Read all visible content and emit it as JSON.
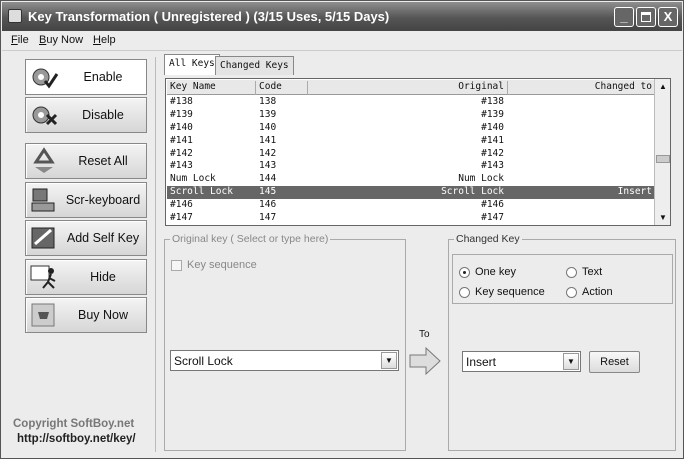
{
  "window": {
    "title": "Key Transformation ( Unregistered ) (3/15 Uses, 5/15 Days)",
    "minimize": "_",
    "maximize": "□",
    "close": "X"
  },
  "menu": [
    "File",
    "Buy Now",
    "Help"
  ],
  "menu_hotkeys": [
    "F",
    "B",
    "H"
  ],
  "sidebar": {
    "buttons": [
      {
        "label": "Enable",
        "icon": "gear-check-icon"
      },
      {
        "label": "Disable",
        "icon": "gear-cross-icon"
      },
      {
        "label": "Reset All",
        "icon": "recycle-icon"
      },
      {
        "label": "Scr-keyboard",
        "icon": "keyboard-icon"
      },
      {
        "label": "Add Self Key",
        "icon": "key-edit-icon"
      },
      {
        "label": "Hide",
        "icon": "running-man-icon"
      },
      {
        "label": "Buy Now",
        "icon": "cart-icon"
      }
    ],
    "copyright": "Copyright  SoftBoy.net",
    "homepage": "http://softboy.net/key/"
  },
  "tabs": [
    "All Keys",
    "Changed Keys"
  ],
  "table": {
    "columns": [
      "Key Name",
      "Code",
      "Original",
      "Changed to"
    ],
    "rows": [
      [
        "#138",
        "138",
        "#138",
        ""
      ],
      [
        "#139",
        "139",
        "#139",
        ""
      ],
      [
        "#140",
        "140",
        "#140",
        ""
      ],
      [
        "#141",
        "141",
        "#141",
        ""
      ],
      [
        "#142",
        "142",
        "#142",
        ""
      ],
      [
        "#143",
        "143",
        "#143",
        ""
      ],
      [
        "Num Lock",
        "144",
        "Num Lock",
        ""
      ],
      [
        "Scroll Lock",
        "145",
        "Scroll Lock",
        "Insert"
      ],
      [
        "#146",
        "146",
        "#146",
        ""
      ],
      [
        "#147",
        "147",
        "#147",
        ""
      ]
    ],
    "selected_row": 7
  },
  "original_key": {
    "group_label": "Original key ( Select or type here)",
    "key_sequence_label": "Key sequence",
    "key_sequence_checked": false,
    "selected": "Scroll Lock"
  },
  "to_label": "To",
  "changed_key": {
    "group_label": "Changed Key",
    "options": [
      "One key",
      "Text",
      "Key sequence",
      "Action"
    ],
    "selected_option": "One key",
    "selected": "Insert",
    "reset_label": "Reset"
  }
}
